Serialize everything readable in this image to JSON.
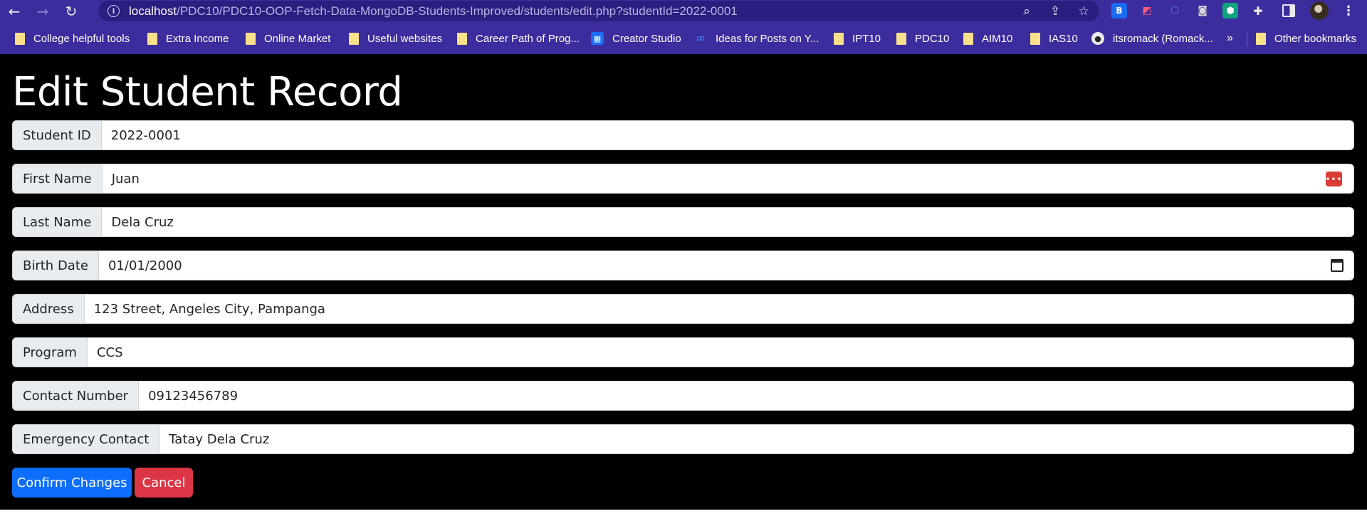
{
  "browser": {
    "url_host": "localhost",
    "url_path": "/PDC10/PDC10-OOP-Fetch-Data-MongoDB-Students-Improved/students/edit.php?studentId=2022-0001"
  },
  "bookmarks": [
    {
      "label": "College helpful tools",
      "icon": "folder-icon"
    },
    {
      "label": "Extra Income",
      "icon": "folder-icon"
    },
    {
      "label": "Online Market",
      "icon": "folder-icon"
    },
    {
      "label": "Useful websites",
      "icon": "folder-icon"
    },
    {
      "label": "Career Path of Prog...",
      "icon": "folder-icon"
    },
    {
      "label": "Creator Studio",
      "icon": "creator-studio-icon"
    },
    {
      "label": "Ideas for Posts on Y...",
      "icon": "meta-icon"
    },
    {
      "label": "IPT10",
      "icon": "folder-icon"
    },
    {
      "label": "PDC10",
      "icon": "folder-icon"
    },
    {
      "label": "AIM10",
      "icon": "folder-icon"
    },
    {
      "label": "IAS10",
      "icon": "folder-icon"
    },
    {
      "label": "itsromack (Romack...",
      "icon": "github-icon"
    }
  ],
  "bookmarks_overflow": "»",
  "other_bookmarks": "Other bookmarks",
  "page": {
    "title": "Edit Student Record",
    "fields": [
      {
        "label": "Student ID",
        "value": "2022-0001"
      },
      {
        "label": "First Name",
        "value": "Juan"
      },
      {
        "label": "Last Name",
        "value": "Dela Cruz"
      },
      {
        "label": "Birth Date",
        "value": "01/01/2000"
      },
      {
        "label": "Address",
        "value": "123 Street, Angeles City, Pampanga"
      },
      {
        "label": "Program",
        "value": "CCS"
      },
      {
        "label": "Contact Number",
        "value": "09123456789"
      },
      {
        "label": "Emergency Contact",
        "value": "Tatay Dela Cruz"
      }
    ],
    "confirm_label": "Confirm Changes",
    "cancel_label": "Cancel"
  },
  "colors": {
    "primary": "#0d6efd",
    "danger": "#dc3545",
    "browser_theme": "#3c2d9e"
  }
}
